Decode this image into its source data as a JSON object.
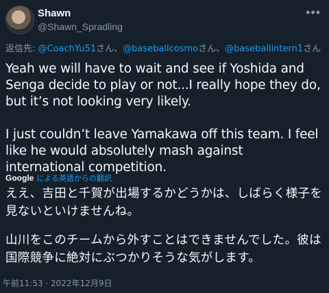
{
  "author": {
    "display_name": "Shawn",
    "handle": "@Shawn_Spradling"
  },
  "more_glyph": "•••",
  "reply": {
    "prefix": "返信先: ",
    "mentions": [
      "@CoachYu51",
      "@baseballcosmo",
      "@baseballintern1"
    ],
    "suffix": "さん",
    "separator": "、"
  },
  "tweet": {
    "paragraphs": [
      "Yeah we will have to wait and see if Yoshida and Senga decide to play or not...I really hope they do, but it’s not looking very likely.",
      "I just couldn’t leave Yamakawa off this team. I feel like he would absolutely mash against international competition."
    ]
  },
  "translation": {
    "provider": "Google",
    "label": "による英語からの翻訳",
    "paragraphs": [
      "ええ、吉田と千賀が出場するかどうかは、しばらく様子を見ないといけませんね。",
      "山川をこのチームから外すことはできませんでした。彼は国際競争に絶対にぶつかりそうな気がします。"
    ]
  },
  "timestamp": "午前11:53 · 2022年12月9日"
}
